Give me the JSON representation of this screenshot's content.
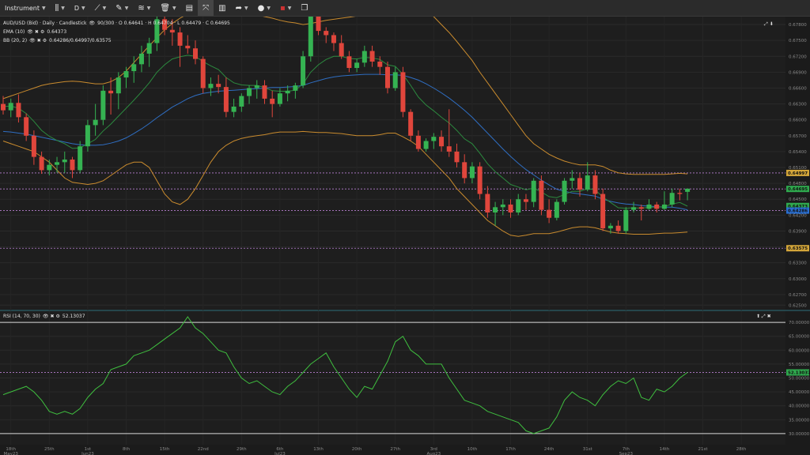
{
  "toolbar": {
    "instrument_label": "Instrument",
    "timeframe_label": "D",
    "items": [
      "candle-type",
      "crosshair-tool",
      "draw-tool",
      "indicators",
      "delete",
      "layout",
      "fullscreen",
      "chart-style",
      "share",
      "language",
      "window"
    ]
  },
  "main_legend": {
    "symbol": "AUD/USD (Bid) · Daily · Candlestick",
    "ohlc": "90/300 · O 0.64641 · H 0.64704 · L 0.64479 · C 0.64695",
    "ema": "EMA (10)",
    "ema_value": "0.64373",
    "bb": "BB (20, 2)",
    "bb_value": "0.64286/0.64997/0.63575"
  },
  "rsi_legend": {
    "label": "RSI (14, 70, 30)",
    "value": "52.13037"
  },
  "chart_data": [
    {
      "type": "candlestick",
      "title": "AUD/USD (Bid) · Daily · Candlestick",
      "ylim": [
        0.624,
        0.6795
      ],
      "y_ticks": [
        "0.67800",
        "0.67500",
        "0.67200",
        "0.66900",
        "0.66600",
        "0.66300",
        "0.66000",
        "0.65700",
        "0.65400",
        "0.65100",
        "0.64800",
        "0.64500",
        "0.64200",
        "0.63900",
        "0.63600",
        "0.63300",
        "0.63000",
        "0.62700",
        "0.62500"
      ],
      "x_ticks": [
        [
          "18th",
          "May23"
        ],
        [
          "25th",
          ""
        ],
        [
          "1st",
          "Jun23"
        ],
        [
          "8th",
          ""
        ],
        [
          "15th",
          ""
        ],
        [
          "22nd",
          ""
        ],
        [
          "29th",
          ""
        ],
        [
          "6th",
          "Jul23"
        ],
        [
          "13th",
          ""
        ],
        [
          "20th",
          ""
        ],
        [
          "27th",
          ""
        ],
        [
          "3rd",
          "Aug23"
        ],
        [
          "10th",
          ""
        ],
        [
          "17th",
          ""
        ],
        [
          "24th",
          ""
        ],
        [
          "31st",
          ""
        ],
        [
          "7th",
          "Sep23"
        ],
        [
          "14th",
          ""
        ],
        [
          "21st",
          ""
        ],
        [
          "28th",
          ""
        ]
      ],
      "candles": [
        [
          0.663,
          0.6645,
          0.661,
          0.6618
        ],
        [
          0.6618,
          0.664,
          0.6605,
          0.6632
        ],
        [
          0.6632,
          0.6648,
          0.6595,
          0.6605
        ],
        [
          0.6605,
          0.6612,
          0.656,
          0.657
        ],
        [
          0.657,
          0.658,
          0.6515,
          0.653
        ],
        [
          0.653,
          0.654,
          0.6498,
          0.6505
        ],
        [
          0.6505,
          0.6525,
          0.6495,
          0.6515
        ],
        [
          0.6515,
          0.653,
          0.65,
          0.652
        ],
        [
          0.652,
          0.654,
          0.65,
          0.6525
        ],
        [
          0.6525,
          0.653,
          0.649,
          0.6505
        ],
        [
          0.6505,
          0.656,
          0.65,
          0.655
        ],
        [
          0.655,
          0.66,
          0.654,
          0.659
        ],
        [
          0.659,
          0.663,
          0.657,
          0.66
        ],
        [
          0.66,
          0.6665,
          0.659,
          0.6655
        ],
        [
          0.6655,
          0.668,
          0.661,
          0.665
        ],
        [
          0.665,
          0.669,
          0.662,
          0.668
        ],
        [
          0.668,
          0.67,
          0.666,
          0.6692
        ],
        [
          0.6692,
          0.672,
          0.667,
          0.6705
        ],
        [
          0.6705,
          0.674,
          0.669,
          0.6725
        ],
        [
          0.6725,
          0.6755,
          0.67,
          0.6745
        ],
        [
          0.6745,
          0.68,
          0.673,
          0.679
        ],
        [
          0.679,
          0.681,
          0.676,
          0.677
        ],
        [
          0.677,
          0.679,
          0.674,
          0.6765
        ],
        [
          0.6765,
          0.6775,
          0.67,
          0.674
        ],
        [
          0.674,
          0.676,
          0.6725,
          0.6735
        ],
        [
          0.6735,
          0.675,
          0.6705,
          0.6715
        ],
        [
          0.6715,
          0.672,
          0.665,
          0.666
        ],
        [
          0.666,
          0.668,
          0.6645,
          0.6668
        ],
        [
          0.6668,
          0.6685,
          0.665,
          0.6662
        ],
        [
          0.6662,
          0.668,
          0.6605,
          0.6615
        ],
        [
          0.6615,
          0.664,
          0.6605,
          0.6625
        ],
        [
          0.6625,
          0.665,
          0.6615,
          0.6645
        ],
        [
          0.6645,
          0.6665,
          0.663,
          0.666
        ],
        [
          0.666,
          0.6675,
          0.664,
          0.6665
        ],
        [
          0.6665,
          0.6675,
          0.663,
          0.664
        ],
        [
          0.664,
          0.6655,
          0.6605,
          0.663
        ],
        [
          0.663,
          0.666,
          0.6625,
          0.665
        ],
        [
          0.665,
          0.6665,
          0.6635,
          0.6655
        ],
        [
          0.6655,
          0.667,
          0.664,
          0.6665
        ],
        [
          0.6665,
          0.673,
          0.666,
          0.672
        ],
        [
          0.672,
          0.68,
          0.671,
          0.6795
        ],
        [
          0.6795,
          0.68,
          0.676,
          0.6768
        ],
        [
          0.6768,
          0.6775,
          0.6745,
          0.676
        ],
        [
          0.676,
          0.6765,
          0.673,
          0.6745
        ],
        [
          0.6745,
          0.676,
          0.6715,
          0.672
        ],
        [
          0.672,
          0.673,
          0.669,
          0.6698
        ],
        [
          0.6698,
          0.6715,
          0.669,
          0.6708
        ],
        [
          0.6708,
          0.674,
          0.67,
          0.673
        ],
        [
          0.673,
          0.674,
          0.67,
          0.671
        ],
        [
          0.671,
          0.672,
          0.6685,
          0.67
        ],
        [
          0.67,
          0.671,
          0.665,
          0.666
        ],
        [
          0.666,
          0.67,
          0.6655,
          0.669
        ],
        [
          0.669,
          0.67,
          0.6605,
          0.6615
        ],
        [
          0.6615,
          0.662,
          0.656,
          0.657
        ],
        [
          0.657,
          0.658,
          0.654,
          0.6545
        ],
        [
          0.6545,
          0.6565,
          0.654,
          0.656
        ],
        [
          0.656,
          0.6575,
          0.6545,
          0.6568
        ],
        [
          0.6568,
          0.658,
          0.654,
          0.655
        ],
        [
          0.655,
          0.662,
          0.653,
          0.654
        ],
        [
          0.654,
          0.6555,
          0.651,
          0.652
        ],
        [
          0.652,
          0.6535,
          0.648,
          0.649
        ],
        [
          0.649,
          0.652,
          0.648,
          0.6512
        ],
        [
          0.6512,
          0.652,
          0.645,
          0.646
        ],
        [
          0.646,
          0.6475,
          0.6415,
          0.6425
        ],
        [
          0.6425,
          0.6445,
          0.64,
          0.6435
        ],
        [
          0.6435,
          0.645,
          0.642,
          0.644
        ],
        [
          0.644,
          0.645,
          0.6415,
          0.6425
        ],
        [
          0.6425,
          0.646,
          0.642,
          0.645
        ],
        [
          0.645,
          0.646,
          0.643,
          0.6445
        ],
        [
          0.6445,
          0.649,
          0.6435,
          0.6485
        ],
        [
          0.6485,
          0.6495,
          0.642,
          0.643
        ],
        [
          0.643,
          0.645,
          0.6405,
          0.6415
        ],
        [
          0.6415,
          0.645,
          0.641,
          0.6445
        ],
        [
          0.6445,
          0.649,
          0.644,
          0.6485
        ],
        [
          0.6485,
          0.6505,
          0.647,
          0.649
        ],
        [
          0.649,
          0.65,
          0.6455,
          0.6468
        ],
        [
          0.6468,
          0.652,
          0.6465,
          0.6495
        ],
        [
          0.6495,
          0.6505,
          0.645,
          0.646
        ],
        [
          0.646,
          0.647,
          0.639,
          0.6395
        ],
        [
          0.6395,
          0.6405,
          0.6385,
          0.64
        ],
        [
          0.64,
          0.641,
          0.6385,
          0.639
        ],
        [
          0.639,
          0.6435,
          0.6385,
          0.643
        ],
        [
          0.643,
          0.6445,
          0.6425,
          0.6435
        ],
        [
          0.6435,
          0.644,
          0.641,
          0.6432
        ],
        [
          0.6432,
          0.645,
          0.643,
          0.644
        ],
        [
          0.644,
          0.6445,
          0.6425,
          0.6432
        ],
        [
          0.6432,
          0.6465,
          0.643,
          0.644
        ],
        [
          0.644,
          0.647,
          0.6435,
          0.6462
        ],
        [
          0.6462,
          0.647,
          0.6448,
          0.646
        ],
        [
          0.6464,
          0.647,
          0.6448,
          0.647
        ]
      ],
      "ema": [
        0.6625,
        0.6626,
        0.6622,
        0.6612,
        0.6597,
        0.658,
        0.6569,
        0.6561,
        0.6555,
        0.6546,
        0.6547,
        0.6555,
        0.6563,
        0.6579,
        0.6592,
        0.6607,
        0.6622,
        0.6637,
        0.6653,
        0.667,
        0.669,
        0.6704,
        0.6715,
        0.6719,
        0.6722,
        0.672,
        0.671,
        0.6702,
        0.6695,
        0.668,
        0.667,
        0.6666,
        0.6665,
        0.6665,
        0.6661,
        0.6655,
        0.6654,
        0.6654,
        0.6656,
        0.6668,
        0.669,
        0.6704,
        0.6714,
        0.672,
        0.672,
        0.6716,
        0.6715,
        0.6718,
        0.6717,
        0.6714,
        0.6704,
        0.6701,
        0.6686,
        0.6665,
        0.6643,
        0.6628,
        0.6617,
        0.6605,
        0.6594,
        0.658,
        0.6564,
        0.6555,
        0.6537,
        0.6517,
        0.6502,
        0.649,
        0.6478,
        0.6473,
        0.6468,
        0.6471,
        0.6464,
        0.6455,
        0.6453,
        0.6459,
        0.6465,
        0.6465,
        0.647,
        0.6468,
        0.6454,
        0.6444,
        0.6434,
        0.6433,
        0.6434,
        0.6433,
        0.6435,
        0.6435,
        0.6436,
        0.6441,
        0.6444,
        0.6437
      ],
      "bb_mid": [
        0.6578,
        0.6577,
        0.6575,
        0.6573,
        0.657,
        0.6567,
        0.6564,
        0.6561,
        0.6558,
        0.6555,
        0.6553,
        0.6552,
        0.6552,
        0.6553,
        0.6556,
        0.656,
        0.6566,
        0.6574,
        0.6583,
        0.6593,
        0.6604,
        0.6614,
        0.6624,
        0.6632,
        0.664,
        0.6646,
        0.665,
        0.6652,
        0.6654,
        0.6655,
        0.6656,
        0.6657,
        0.6658,
        0.6659,
        0.666,
        0.6661,
        0.6661,
        0.6662,
        0.6663,
        0.6665,
        0.667,
        0.6674,
        0.6678,
        0.6681,
        0.6683,
        0.6684,
        0.6685,
        0.6686,
        0.6686,
        0.6686,
        0.6685,
        0.6685,
        0.6684,
        0.668,
        0.6675,
        0.6668,
        0.666,
        0.6651,
        0.6641,
        0.663,
        0.6618,
        0.6605,
        0.659,
        0.6575,
        0.656,
        0.6545,
        0.6531,
        0.6518,
        0.6506,
        0.6496,
        0.6486,
        0.6477,
        0.6469,
        0.6465,
        0.6462,
        0.646,
        0.6458,
        0.6456,
        0.645,
        0.6446,
        0.6443,
        0.6441,
        0.644,
        0.6438,
        0.6437,
        0.6436,
        0.6435,
        0.6435,
        0.6433,
        0.643
      ],
      "bb_up": [
        0.664,
        0.6645,
        0.665,
        0.6655,
        0.666,
        0.6665,
        0.6668,
        0.667,
        0.6672,
        0.6673,
        0.6672,
        0.667,
        0.6668,
        0.6668,
        0.6672,
        0.668,
        0.6692,
        0.6708,
        0.6724,
        0.674,
        0.6755,
        0.677,
        0.6782,
        0.6792,
        0.68,
        0.6806,
        0.681,
        0.6812,
        0.6812,
        0.681,
        0.6808,
        0.6805,
        0.6802,
        0.6798,
        0.6795,
        0.6792,
        0.6788,
        0.6785,
        0.6783,
        0.678,
        0.6782,
        0.6785,
        0.6788,
        0.679,
        0.6792,
        0.6794,
        0.6796,
        0.6797,
        0.6799,
        0.6801,
        0.6803,
        0.6805,
        0.6808,
        0.6812,
        0.6812,
        0.6805,
        0.6795,
        0.678,
        0.6765,
        0.6748,
        0.673,
        0.6712,
        0.669,
        0.667,
        0.665,
        0.663,
        0.661,
        0.659,
        0.657,
        0.6555,
        0.6545,
        0.6535,
        0.6528,
        0.6522,
        0.6518,
        0.6515,
        0.6515,
        0.6515,
        0.6512,
        0.6505,
        0.65,
        0.6498,
        0.6497,
        0.6497,
        0.6497,
        0.6497,
        0.6497,
        0.6498,
        0.6499,
        0.6498
      ],
      "bb_lo": [
        0.656,
        0.6555,
        0.655,
        0.6545,
        0.654,
        0.653,
        0.652,
        0.6505,
        0.649,
        0.6482,
        0.648,
        0.6478,
        0.648,
        0.6485,
        0.6495,
        0.6505,
        0.6515,
        0.652,
        0.652,
        0.651,
        0.6485,
        0.646,
        0.6445,
        0.644,
        0.645,
        0.647,
        0.6495,
        0.652,
        0.654,
        0.6552,
        0.656,
        0.6565,
        0.6568,
        0.657,
        0.6572,
        0.6575,
        0.6577,
        0.6577,
        0.6577,
        0.6578,
        0.6577,
        0.6576,
        0.6576,
        0.6575,
        0.6574,
        0.6572,
        0.657,
        0.657,
        0.657,
        0.6572,
        0.6575,
        0.6575,
        0.6568,
        0.656,
        0.655,
        0.6535,
        0.652,
        0.6505,
        0.649,
        0.647,
        0.6455,
        0.644,
        0.6425,
        0.641,
        0.64,
        0.639,
        0.6382,
        0.638,
        0.6382,
        0.6385,
        0.6385,
        0.6385,
        0.6388,
        0.6392,
        0.6396,
        0.6398,
        0.6398,
        0.6396,
        0.6392,
        0.6388,
        0.6386,
        0.6385,
        0.6384,
        0.6384,
        0.6384,
        0.6385,
        0.6386,
        0.6386,
        0.6387,
        0.6388
      ],
      "price_tags": [
        {
          "value": 0.64997,
          "text": "0.64997",
          "color": "#d4a63a"
        },
        {
          "value": 0.64695,
          "text": "0.64695",
          "color": "#2fa94e"
        },
        {
          "value": 0.64373,
          "text": "0.64373",
          "color": "#2fa94e"
        },
        {
          "value": 0.64286,
          "text": "0.64286",
          "color": "#2a6fd1"
        },
        {
          "value": 0.63575,
          "text": "0.63575",
          "color": "#d4a63a"
        }
      ]
    },
    {
      "type": "line",
      "title": "RSI (14, 70, 30)",
      "ylim": [
        26,
        74
      ],
      "y_ticks": [
        "75.00000",
        "70.00000",
        "65.00000",
        "60.00000",
        "55.00000",
        "50.00000",
        "45.00000",
        "40.00000",
        "35.00000",
        "30.00000",
        "25.00000"
      ],
      "levels": [
        70,
        30
      ],
      "current_tag": "52.13037",
      "values": [
        44,
        45,
        46,
        47,
        45,
        42,
        38,
        37,
        38,
        37,
        39,
        43,
        46,
        48,
        53,
        54,
        55,
        58,
        59,
        60,
        62,
        64,
        66,
        68,
        72,
        68,
        66,
        63,
        60,
        59,
        54,
        50,
        48,
        49,
        47,
        45,
        44,
        47,
        49,
        52,
        55,
        57,
        59,
        54,
        50,
        46,
        43,
        47,
        46,
        51,
        56,
        63,
        65,
        60,
        58,
        55,
        55,
        55,
        50,
        46,
        42,
        41,
        40,
        38,
        37,
        36,
        35,
        34,
        31,
        30,
        31,
        32,
        36,
        42,
        45,
        43,
        42,
        40,
        44,
        47,
        49,
        48,
        50,
        43,
        42,
        46,
        45,
        47,
        50,
        52
      ]
    }
  ]
}
